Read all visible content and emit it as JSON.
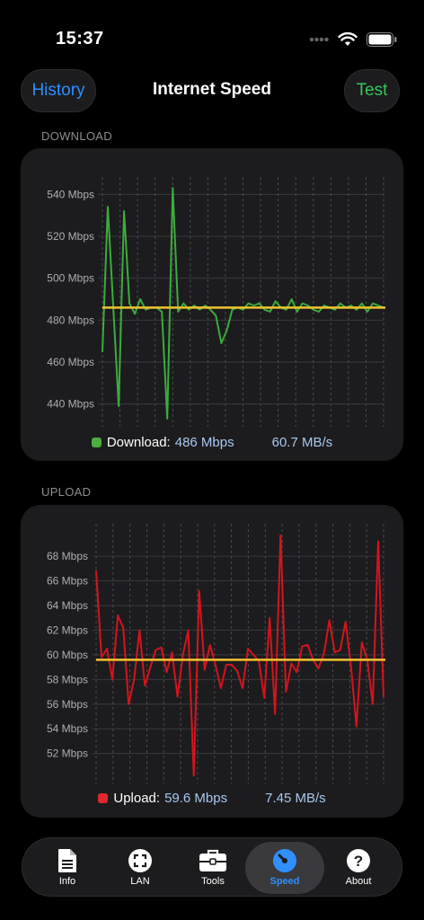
{
  "status": {
    "time": "15:37"
  },
  "nav": {
    "left_button": "History",
    "title": "Internet Speed",
    "right_button": "Test"
  },
  "download": {
    "section_label": "DOWNLOAD",
    "legend_label": "Download:",
    "legend_value": "486 Mbps",
    "legend_bytes": "60.7 MB/s",
    "color": "#3cac3c",
    "average": 486,
    "y_ticks": [
      {
        "value": 540,
        "label": "540 Mbps"
      },
      {
        "value": 520,
        "label": "520 Mbps"
      },
      {
        "value": 500,
        "label": "500 Mbps"
      },
      {
        "value": 480,
        "label": "480 Mbps"
      },
      {
        "value": 460,
        "label": "460 Mbps"
      },
      {
        "value": 440,
        "label": "440 Mbps"
      }
    ],
    "ylim": [
      433,
      544
    ],
    "values": [
      465,
      534,
      487,
      439,
      532,
      488,
      483,
      490,
      485,
      486,
      486,
      484,
      433,
      543,
      484,
      488,
      485,
      487,
      485,
      487,
      485,
      482,
      469,
      475,
      485,
      486,
      485,
      488,
      487,
      488,
      485,
      484,
      489,
      486,
      485,
      490,
      484,
      488,
      487,
      485,
      484,
      487,
      486,
      485,
      488,
      486,
      487,
      485,
      488,
      484,
      488,
      487,
      486
    ]
  },
  "upload": {
    "section_label": "UPLOAD",
    "legend_label": "Upload:",
    "legend_value": "59.6 Mbps",
    "legend_bytes": "7.45 MB/s",
    "color": "#d4141e",
    "average": 59.6,
    "y_ticks": [
      {
        "value": 68,
        "label": "68 Mbps"
      },
      {
        "value": 66,
        "label": "66 Mbps"
      },
      {
        "value": 64,
        "label": "64 Mbps"
      },
      {
        "value": 62,
        "label": "62 Mbps"
      },
      {
        "value": 60,
        "label": "60 Mbps"
      },
      {
        "value": 58,
        "label": "58 Mbps"
      },
      {
        "value": 56,
        "label": "56 Mbps"
      },
      {
        "value": 54,
        "label": "54 Mbps"
      },
      {
        "value": 52,
        "label": "52 Mbps"
      }
    ],
    "ylim": [
      50.3,
      69.9
    ],
    "values": [
      66.8,
      59.8,
      60.5,
      58.0,
      63.2,
      62.2,
      56.0,
      58.0,
      62.0,
      57.5,
      59.0,
      60.4,
      60.6,
      58.6,
      60.2,
      56.6,
      60.0,
      62.0,
      50.2,
      65.2,
      58.8,
      60.8,
      59.2,
      57.3,
      59.2,
      59.2,
      58.7,
      57.3,
      60.5,
      60.0,
      59.5,
      56.5,
      63.0,
      55.2,
      69.7,
      57.0,
      59.3,
      58.6,
      60.7,
      60.8,
      59.6,
      58.9,
      60.1,
      62.8,
      60.2,
      60.4,
      62.7,
      59.0,
      54.2,
      61.0,
      59.6,
      56.0,
      69.2,
      56.6
    ]
  },
  "tabs": [
    {
      "label": "Info",
      "icon": "doc-icon"
    },
    {
      "label": "LAN",
      "icon": "lan-icon"
    },
    {
      "label": "Tools",
      "icon": "toolbox-icon"
    },
    {
      "label": "Speed",
      "icon": "speedometer-icon"
    },
    {
      "label": "About",
      "icon": "question-icon"
    }
  ],
  "colors": {
    "accent_blue": "#2f8fff",
    "green": "#32c759",
    "average_line": "#f2c230"
  }
}
